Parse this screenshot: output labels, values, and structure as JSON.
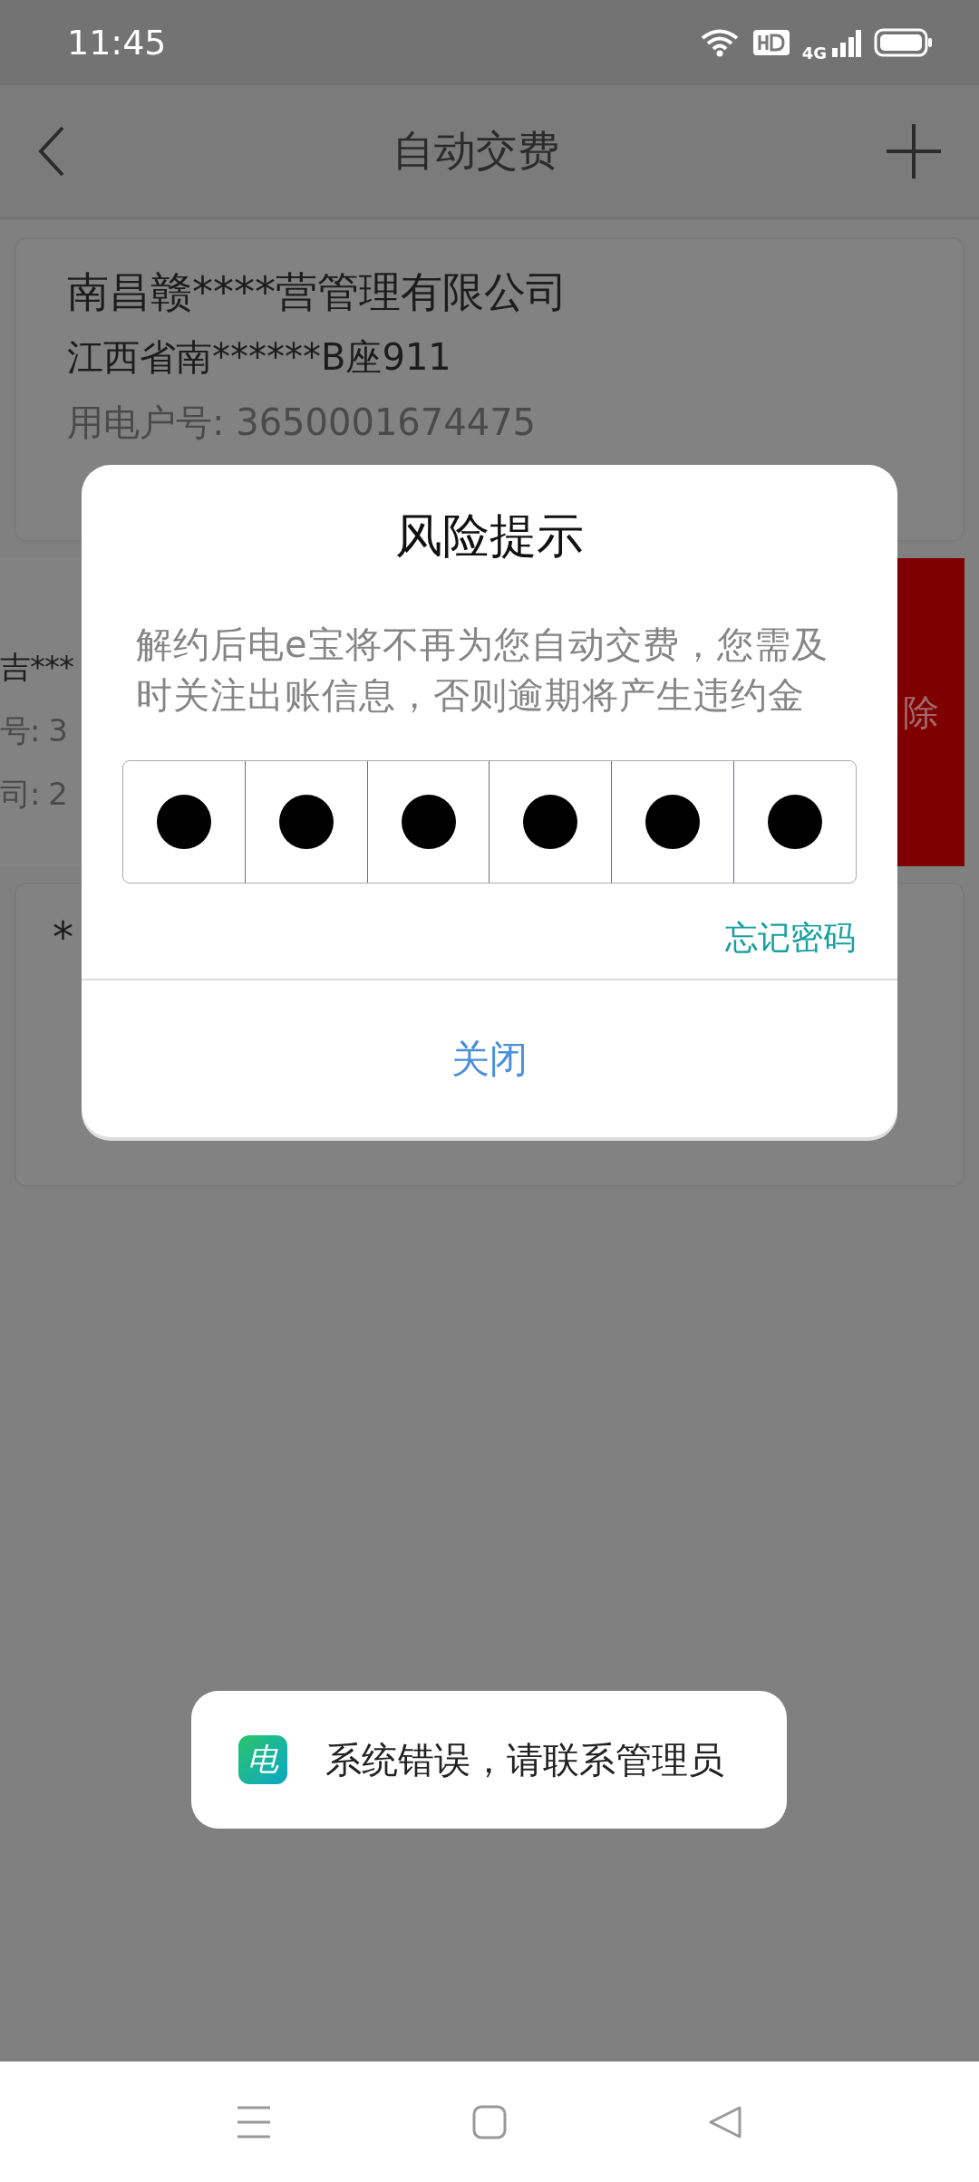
{
  "status_bar": {
    "time": "11:45",
    "network": "4G"
  },
  "header": {
    "title": "自动交费"
  },
  "cards": [
    {
      "kind": "full",
      "lines": [
        {
          "kind": "title",
          "text": "南昌赣****营管理有限公司"
        },
        {
          "kind": "address",
          "text": "江西省南******B座911"
        },
        {
          "kind": "meta",
          "text": "用电户号: 3650001674475"
        }
      ]
    },
    {
      "kind": "swiped",
      "lines": [
        {
          "kind": "title",
          "text": "吉***"
        },
        {
          "kind": "meta",
          "text": "号: 3"
        },
        {
          "kind": "meta",
          "text": "司: 2"
        }
      ],
      "delete_label": "除"
    },
    {
      "kind": "full",
      "lines": [
        {
          "kind": "title",
          "text": "*"
        }
      ]
    }
  ],
  "dialog": {
    "title": "风险提示",
    "message": "解约后电e宝将不再为您自动交费，您需及时关注出账信息，否则逾期将产生违约金",
    "pin": [
      {
        "filled": true
      },
      {
        "filled": true
      },
      {
        "filled": true
      },
      {
        "filled": true
      },
      {
        "filled": true
      },
      {
        "filled": true
      }
    ],
    "forgot_link": "忘记密码",
    "close_button": "关闭"
  },
  "toast": {
    "app_icon_glyph": "电",
    "message": "系统错误，请联系管理员"
  }
}
